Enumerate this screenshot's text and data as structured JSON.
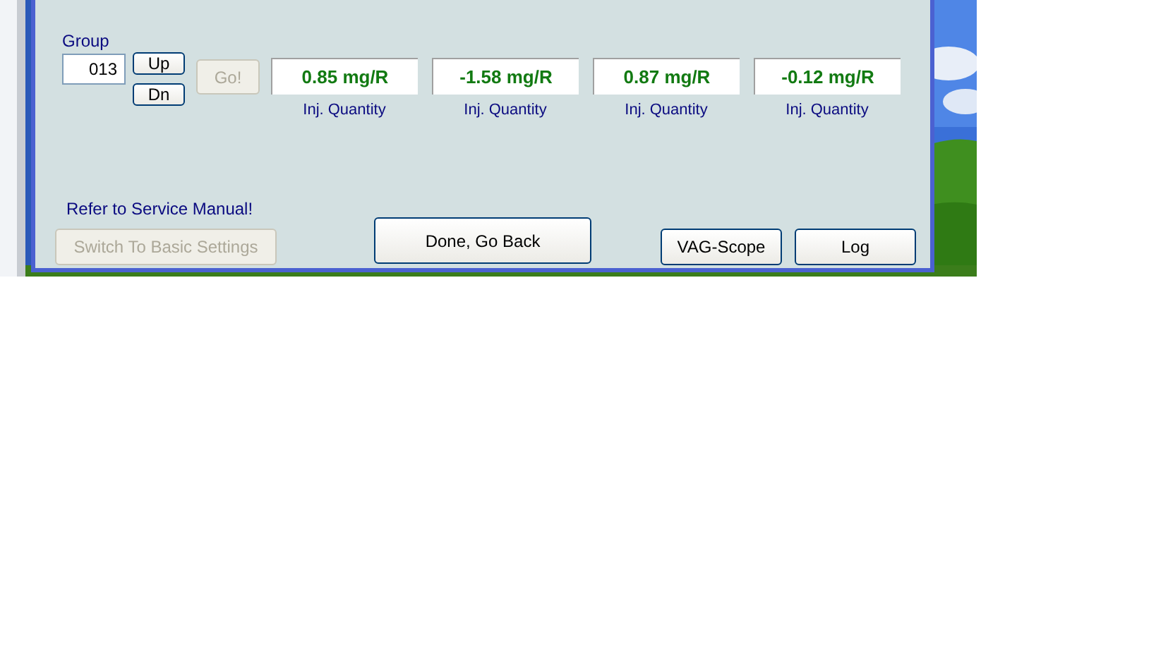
{
  "group": {
    "label": "Group",
    "value": "013"
  },
  "step_buttons": [
    {
      "label": "Up"
    },
    {
      "label": "Dn"
    }
  ],
  "go_button": {
    "label": "Go!",
    "disabled": true
  },
  "readings": [
    {
      "value": "0.85 mg/R",
      "label": "Inj. Quantity"
    },
    {
      "value": "-1.58 mg/R",
      "label": "Inj. Quantity"
    },
    {
      "value": "0.87 mg/R",
      "label": "Inj. Quantity"
    },
    {
      "value": "-0.12 mg/R",
      "label": "Inj. Quantity"
    }
  ],
  "note": "Refer to Service Manual!",
  "basic_settings_button": {
    "label": "Switch To Basic Settings",
    "disabled": true
  },
  "done_button": {
    "label": "Done, Go Back"
  },
  "buttons": [
    {
      "label": "VAG-Scope"
    },
    {
      "label": "Log"
    }
  ]
}
